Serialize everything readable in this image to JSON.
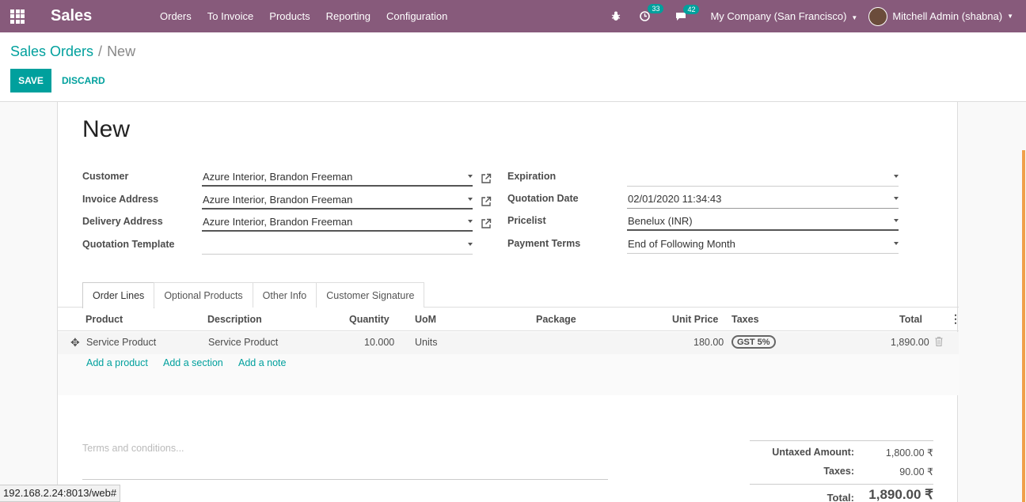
{
  "navbar": {
    "brand": "Sales",
    "menu": [
      "Orders",
      "To Invoice",
      "Products",
      "Reporting",
      "Configuration"
    ],
    "activity_count": "33",
    "message_count": "42",
    "company": "My Company (San Francisco)",
    "user": "Mitchell Admin (shabna)"
  },
  "breadcrumb": {
    "parent": "Sales Orders",
    "current": "New"
  },
  "buttons": {
    "save": "SAVE",
    "discard": "DISCARD"
  },
  "record": {
    "title": "New"
  },
  "fields": {
    "customer_label": "Customer",
    "customer": "Azure Interior, Brandon Freeman",
    "invoice_label": "Invoice Address",
    "invoice": "Azure Interior, Brandon Freeman",
    "delivery_label": "Delivery Address",
    "delivery": "Azure Interior, Brandon Freeman",
    "template_label": "Quotation Template",
    "template": "",
    "expiration_label": "Expiration",
    "expiration": "",
    "qdate_label": "Quotation Date",
    "qdate": "02/01/2020 11:34:43",
    "pricelist_label": "Pricelist",
    "pricelist": "Benelux (INR)",
    "terms_label": "Payment Terms",
    "terms": "End of Following Month"
  },
  "tabs": [
    "Order Lines",
    "Optional Products",
    "Other Info",
    "Customer Signature"
  ],
  "table": {
    "headers": {
      "product": "Product",
      "description": "Description",
      "quantity": "Quantity",
      "uom": "UoM",
      "package": "Package",
      "unit_price": "Unit Price",
      "taxes": "Taxes",
      "total": "Total"
    },
    "row": {
      "product": "Service Product",
      "description": "Service Product",
      "quantity": "10.000",
      "uom": "Units",
      "unit_price": "180.00",
      "tax": "GST 5%",
      "total": "1,890.00"
    },
    "add_product": "Add a product",
    "add_section": "Add a section",
    "add_note": "Add a note"
  },
  "terms_placeholder": "Terms and conditions...",
  "totals": {
    "untaxed_label": "Untaxed Amount:",
    "untaxed": "1,800.00 ₹",
    "taxes_label": "Taxes:",
    "taxes": "90.00 ₹",
    "total_label": "Total:",
    "total": "1,890.00 ₹"
  },
  "status_url": "192.168.2.24:8013/web#",
  "colors": {
    "navbar": "#875a7b",
    "accent": "#00a09d"
  }
}
